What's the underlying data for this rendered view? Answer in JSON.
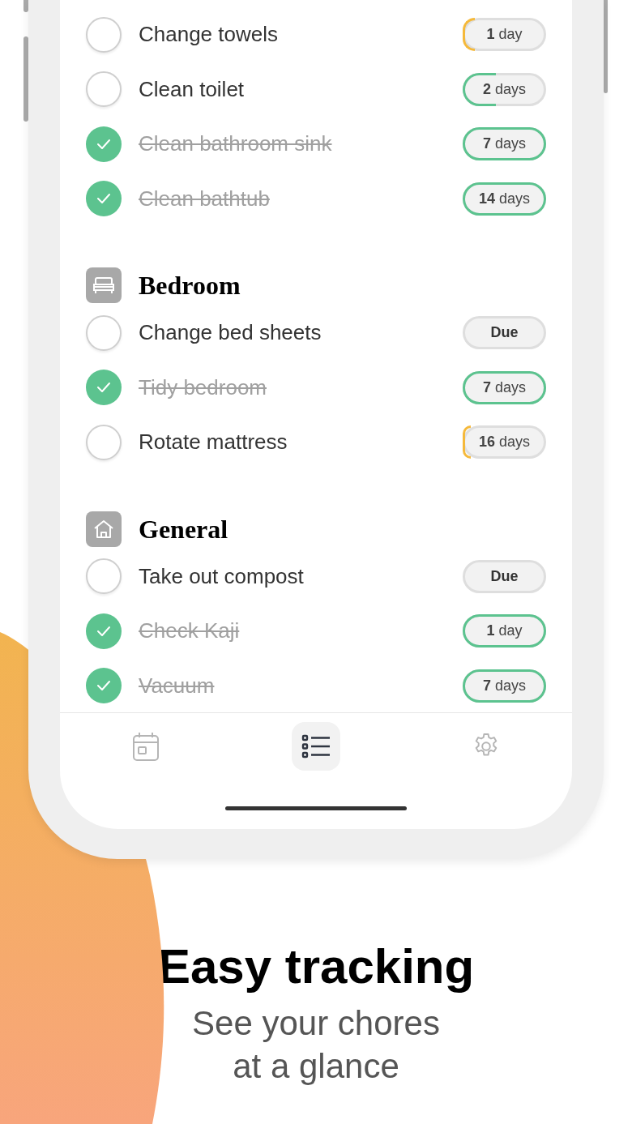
{
  "sections": [
    {
      "tasks": [
        {
          "label": "Change towels",
          "done": false,
          "badge": {
            "kind": "countdown",
            "text": "**1** day",
            "level": 0.15,
            "color": "#f5b93b"
          }
        },
        {
          "label": "Clean toilet",
          "done": false,
          "badge": {
            "kind": "countdown",
            "text": "**2** days",
            "level": 0.4,
            "color": "#5cc38f"
          }
        },
        {
          "label": "Clean bathroom sink",
          "done": true,
          "badge": {
            "kind": "countdown",
            "text": "**7** days",
            "level": 1,
            "color": "#5cc38f"
          }
        },
        {
          "label": "Clean bathtub",
          "done": true,
          "badge": {
            "kind": "countdown",
            "text": "**14** days",
            "level": 1,
            "color": "#5cc38f"
          }
        }
      ]
    },
    {
      "title": "Bedroom",
      "kind": "bedroom",
      "tasks": [
        {
          "label": "Change bed sheets",
          "done": false,
          "badge": {
            "kind": "due",
            "text": "Due"
          }
        },
        {
          "label": "Tidy bedroom",
          "done": true,
          "badge": {
            "kind": "countdown",
            "text": "**7** days",
            "level": 1,
            "color": "#5cc38f"
          }
        },
        {
          "label": "Rotate mattress",
          "done": false,
          "badge": {
            "kind": "countdown",
            "text": "**16** days",
            "level": 0.1,
            "color": "#f5b93b"
          }
        }
      ]
    },
    {
      "title": "General",
      "kind": "general",
      "tasks": [
        {
          "label": "Take out compost",
          "done": false,
          "badge": {
            "kind": "due",
            "text": "Due"
          }
        },
        {
          "label": "Check Kaji",
          "done": true,
          "badge": {
            "kind": "countdown",
            "text": "**1** day",
            "level": 1,
            "color": "#5cc38f"
          }
        },
        {
          "label": "Vacuum",
          "done": true,
          "badge": {
            "kind": "countdown",
            "text": "**7** days",
            "level": 1,
            "color": "#5cc38f"
          }
        }
      ]
    }
  ],
  "tabs": [
    {
      "kind": "calendar",
      "selected": false
    },
    {
      "kind": "list",
      "selected": true
    },
    {
      "kind": "settings",
      "selected": false
    }
  ],
  "headline": "Easy tracking",
  "subtitle": "See your chores at a glance"
}
